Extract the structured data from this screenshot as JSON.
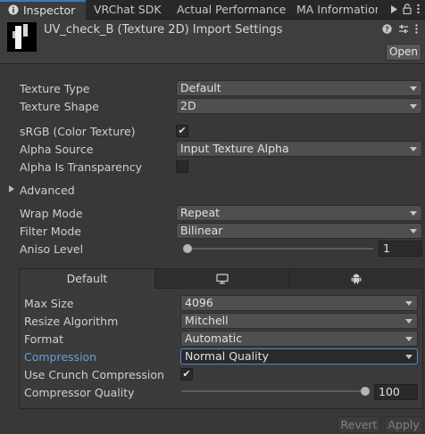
{
  "tabs": [
    {
      "label": "Inspector",
      "active": true,
      "icon": "info-icon"
    },
    {
      "label": "VRChat SDK",
      "active": false
    },
    {
      "label": "Actual Performance",
      "active": false
    },
    {
      "label": "MA Information",
      "active": false
    }
  ],
  "header": {
    "title": "UV_check_B (Texture 2D) Import Settings",
    "open_label": "Open"
  },
  "settings": {
    "texture_type": {
      "label": "Texture Type",
      "value": "Default"
    },
    "texture_shape": {
      "label": "Texture Shape",
      "value": "2D"
    },
    "srgb": {
      "label": "sRGB (Color Texture)",
      "checked": true
    },
    "alpha_source": {
      "label": "Alpha Source",
      "value": "Input Texture Alpha"
    },
    "alpha_is_transparency": {
      "label": "Alpha Is Transparency",
      "checked": false
    },
    "advanced": {
      "label": "Advanced",
      "expanded": false
    },
    "wrap_mode": {
      "label": "Wrap Mode",
      "value": "Repeat"
    },
    "filter_mode": {
      "label": "Filter Mode",
      "value": "Bilinear"
    },
    "aniso_level": {
      "label": "Aniso Level",
      "value": "1",
      "slider_fraction": 0.0
    }
  },
  "platform": {
    "tabs": [
      {
        "label": "Default",
        "icon": null,
        "active": true
      },
      {
        "label": "",
        "icon": "monitor-icon",
        "active": false
      },
      {
        "label": "",
        "icon": "android-icon",
        "active": false
      }
    ],
    "max_size": {
      "label": "Max Size",
      "value": "4096"
    },
    "resize_algorithm": {
      "label": "Resize Algorithm",
      "value": "Mitchell"
    },
    "format": {
      "label": "Format",
      "value": "Automatic"
    },
    "compression": {
      "label": "Compression",
      "value": "Normal Quality"
    },
    "crunch": {
      "label": "Use Crunch Compression",
      "checked": true
    },
    "compressor_quality": {
      "label": "Compressor Quality",
      "value": "100",
      "slider_fraction": 1.0
    }
  },
  "footer": {
    "revert_label": "Revert",
    "apply_label": "Apply"
  },
  "check_glyph": "✔"
}
